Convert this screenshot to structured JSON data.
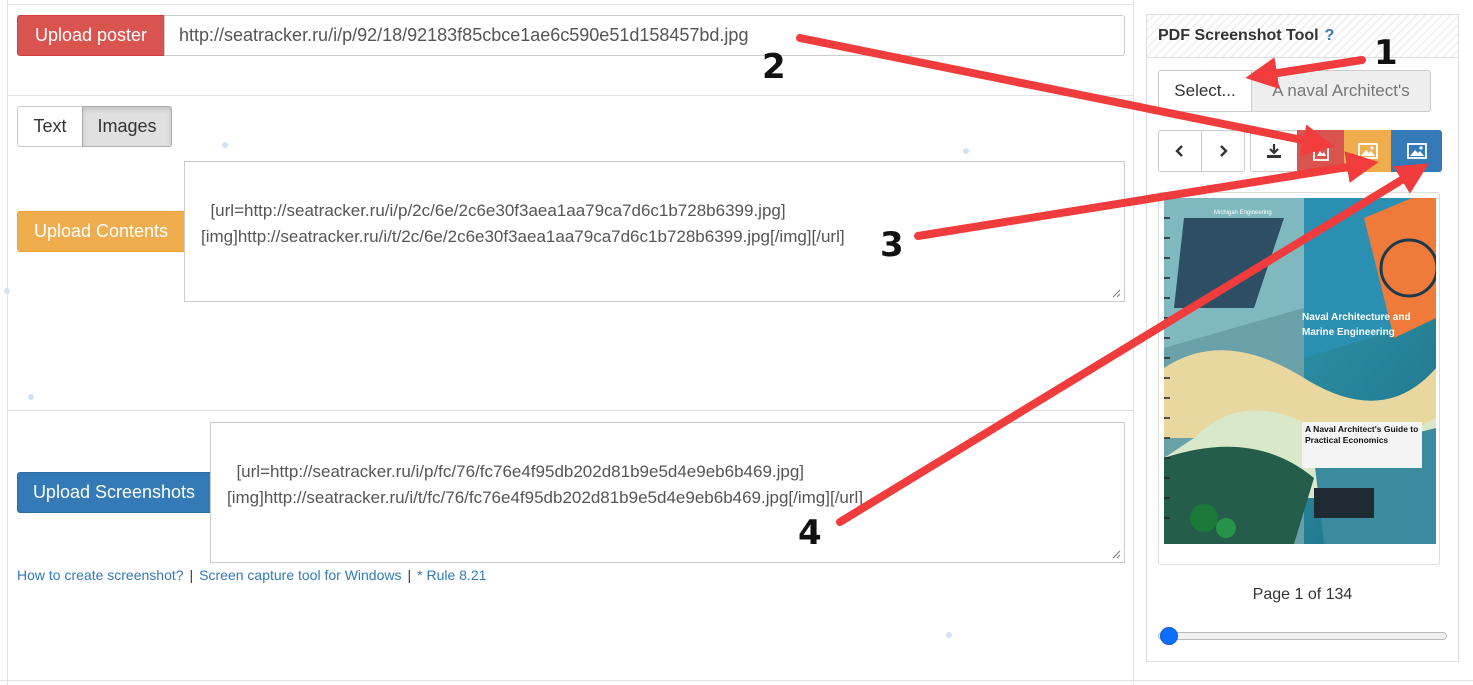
{
  "poster": {
    "button_label": "Upload poster",
    "url_value": "http://seatracker.ru/i/p/92/18/92183f85cbce1ae6c590e51d158457bd.jpg"
  },
  "tabs": [
    {
      "label": "Text",
      "active": false
    },
    {
      "label": "Images",
      "active": true
    }
  ],
  "contents": {
    "button_label": "Upload Contents",
    "text": "[url=http://seatracker.ru/i/p/2c/6e/2c6e30f3aea1aa79ca7d6c1b728b6399.jpg]\n[img]http://seatracker.ru/i/t/2c/6e/2c6e30f3aea1aa79ca7d6c1b728b6399.jpg[/img][/url]"
  },
  "screenshots": {
    "button_label": "Upload Screenshots",
    "text": "[url=http://seatracker.ru/i/p/fc/76/fc76e4f95db202d81b9e5d4e9eb6b469.jpg]\n[img]http://seatracker.ru/i/t/fc/76/fc76e4f95db202d81b9e5d4e9eb6b469.jpg[/img][/url]"
  },
  "help_links": [
    "How to create screenshot?",
    "Screen capture tool for Windows",
    "* Rule 8.21"
  ],
  "pdf_tool": {
    "title": "PDF Screenshot Tool",
    "help": "?",
    "select_label": "Select...",
    "file_name": "A naval Architect's",
    "page_text": "Page 1 of 134",
    "page_fraction": 0.0075,
    "icons": [
      "chevron-left-icon",
      "chevron-right-icon",
      "download-icon",
      "pdf-image-icon",
      "image-orange-icon",
      "image-blue-icon"
    ]
  },
  "cover": {
    "publisher": "Michigan Engineering",
    "title": "Naval Architecture and Marine Engineering",
    "subtitle": "A Naval Architect's Guide to Practical Economics"
  },
  "annotations": [
    "1",
    "2",
    "3",
    "4"
  ],
  "colors": {
    "red": "#d9534f",
    "orange": "#f0ad4e",
    "blue": "#337ab7",
    "arrow": "#f03c3c"
  }
}
